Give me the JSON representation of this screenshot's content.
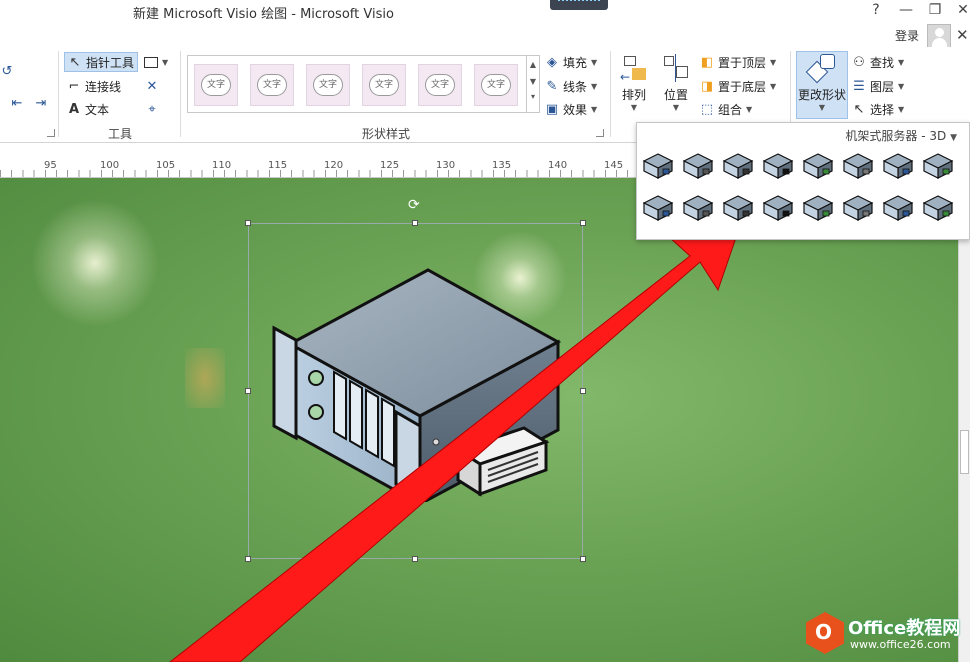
{
  "window": {
    "title": "新建 Microsoft Visio 绘图 - Microsoft Visio",
    "help": "?",
    "minimize": "—",
    "restore": "❐",
    "close": "✕",
    "login": "登录",
    "ribbon_close": "✕"
  },
  "ribbon": {
    "tools": {
      "pointer": "指针工具",
      "connector": "连接线",
      "text": "文本",
      "label": "工具"
    },
    "shape_styles": {
      "swatches": [
        "文字",
        "文字",
        "文字",
        "文字",
        "文字",
        "文字"
      ],
      "fill": "填充",
      "line": "线条",
      "effect": "效果",
      "label": "形状样式"
    },
    "arrange": {
      "arrange": "排列",
      "position": "位置",
      "bring_front": "置于顶层",
      "send_back": "置于底层",
      "group": "组合"
    },
    "editing": {
      "change_shape": "更改形状",
      "find": "查找",
      "layers": "图层",
      "select": "选择"
    }
  },
  "ruler": {
    "ticks": [
      "95",
      "100",
      "105",
      "110",
      "115",
      "120",
      "125",
      "130",
      "135",
      "140",
      "145"
    ]
  },
  "dropdown": {
    "title": "机架式服务器 - 3D",
    "item_count": 16
  },
  "watermark": {
    "logo_letter": "O",
    "name": "Office教程网",
    "url": "www.office26.com"
  },
  "colors": {
    "accent": "#2b5797",
    "selected_bg": "#cfe1f5",
    "arrow": "#ff1a1a",
    "canvas_green": "#6aa254"
  }
}
